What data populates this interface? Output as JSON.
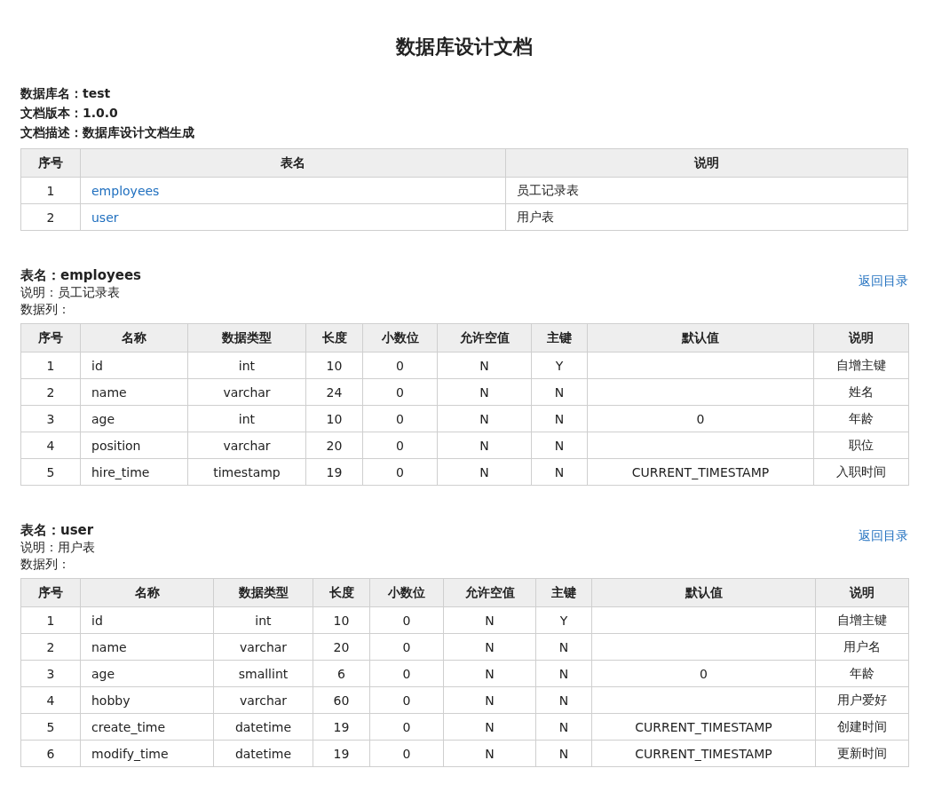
{
  "title": "数据库设计文档",
  "info": [
    "数据库名：test",
    "文档版本：1.0.0",
    "文档描述：数据库设计文档生成"
  ],
  "index_table": {
    "columns": [
      "序号",
      "表名",
      "说明"
    ],
    "rows": [
      [
        "1",
        "employees",
        "员工记录表"
      ],
      [
        "2",
        "user",
        "用户表"
      ]
    ]
  },
  "tables": [
    {
      "heading": "表名：employees",
      "description": "说明：员工记录表",
      "columns_label": "数据列：",
      "back_link": "返回目录",
      "columns": [
        "序号",
        "名称",
        "数据类型",
        "长度",
        "小数位",
        "允许空值",
        "主键",
        "默认值",
        "说明"
      ],
      "rows": [
        [
          "1",
          "id",
          "int",
          "10",
          "0",
          "N",
          "Y",
          "",
          "自增主键"
        ],
        [
          "2",
          "name",
          "varchar",
          "24",
          "0",
          "N",
          "N",
          "",
          "姓名"
        ],
        [
          "3",
          "age",
          "int",
          "10",
          "0",
          "N",
          "N",
          "0",
          "年龄"
        ],
        [
          "4",
          "position",
          "varchar",
          "20",
          "0",
          "N",
          "N",
          "",
          "职位"
        ],
        [
          "5",
          "hire_time",
          "timestamp",
          "19",
          "0",
          "N",
          "N",
          "CURRENT_TIMESTAMP",
          "入职时间"
        ]
      ]
    },
    {
      "heading": "表名：user",
      "description": "说明：用户表",
      "columns_label": "数据列：",
      "back_link": "返回目录",
      "columns": [
        "序号",
        "名称",
        "数据类型",
        "长度",
        "小数位",
        "允许空值",
        "主键",
        "默认值",
        "说明"
      ],
      "rows": [
        [
          "1",
          "id",
          "int",
          "10",
          "0",
          "N",
          "Y",
          "",
          "自增主键"
        ],
        [
          "2",
          "name",
          "varchar",
          "20",
          "0",
          "N",
          "N",
          "",
          "用户名"
        ],
        [
          "3",
          "age",
          "smallint",
          "6",
          "0",
          "N",
          "N",
          "0",
          "年龄"
        ],
        [
          "4",
          "hobby",
          "varchar",
          "60",
          "0",
          "N",
          "N",
          "",
          "用户爱好"
        ],
        [
          "5",
          "create_time",
          "datetime",
          "19",
          "0",
          "N",
          "N",
          "CURRENT_TIMESTAMP",
          "创建时间"
        ],
        [
          "6",
          "modify_time",
          "datetime",
          "19",
          "0",
          "N",
          "N",
          "CURRENT_TIMESTAMP",
          "更新时间"
        ]
      ]
    }
  ]
}
